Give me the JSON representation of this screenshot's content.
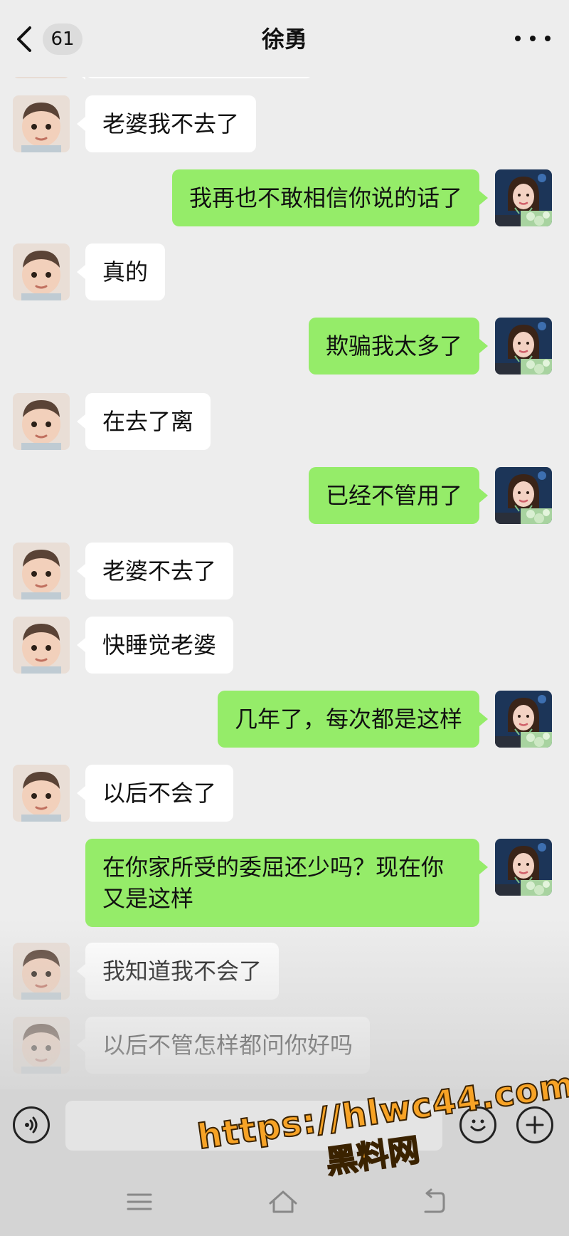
{
  "header": {
    "title": "徐勇",
    "unread_count": "61"
  },
  "colors": {
    "background": "#ededed",
    "sent_bubble": "#95ec69",
    "received_bubble": "#ffffff",
    "watermark": "#f7a326"
  },
  "avatars": {
    "contact": "baby-avatar",
    "self": "woman-avatar"
  },
  "messages": [
    {
      "from": "contact",
      "text": "老婆我不去了"
    },
    {
      "from": "self",
      "text": "我再也不敢相信你说的话了"
    },
    {
      "from": "contact",
      "text": "真的"
    },
    {
      "from": "self",
      "text": "欺骗我太多了"
    },
    {
      "from": "contact",
      "text": "在去了离"
    },
    {
      "from": "self",
      "text": "已经不管用了"
    },
    {
      "from": "contact",
      "text": "老婆不去了"
    },
    {
      "from": "contact",
      "text": "快睡觉老婆"
    },
    {
      "from": "self",
      "text": "几年了，每次都是这样"
    },
    {
      "from": "contact",
      "text": "以后不会了"
    },
    {
      "from": "self",
      "text": "在你家所受的委屈还少吗？现在你又是这样"
    },
    {
      "from": "contact",
      "text": "我知道我不会了"
    },
    {
      "from": "contact",
      "text": "以后不管怎样都问你好吗"
    }
  ],
  "input_bar": {
    "value": "",
    "placeholder": ""
  },
  "watermark": {
    "url": "https://hlwc44.com",
    "name": "黑料网"
  }
}
